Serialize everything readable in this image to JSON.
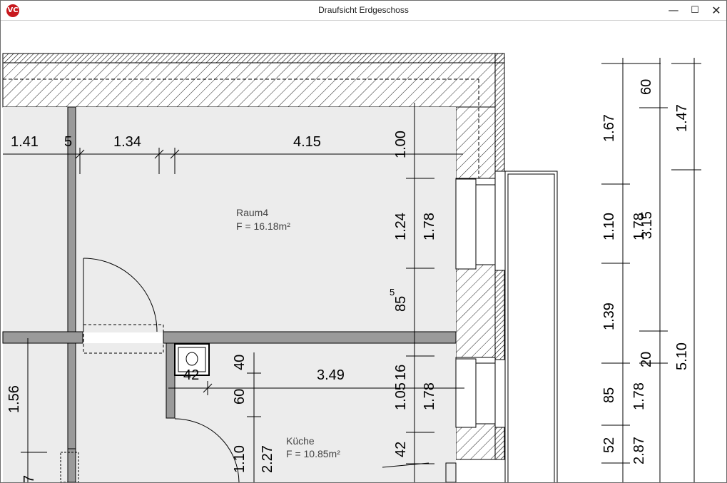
{
  "window": {
    "title": "Draufsicht Erdgeschoss",
    "app_icon_text": "VC",
    "controls": {
      "minimize": "—",
      "maximize": "☐",
      "close": "✕"
    }
  },
  "rooms": [
    {
      "name": "Raum4",
      "area": "F = 16.18m²"
    },
    {
      "name": "Küche",
      "area": "F = 10.85m²"
    }
  ],
  "dims_horizontal": {
    "d1": "1.41",
    "d2": "5",
    "d3": "1.34",
    "d4": "4.15",
    "d5": "3.49",
    "d6": "42"
  },
  "dims_inner_vertical": {
    "a1": "1.00",
    "a2": "1.24",
    "a3": "85",
    "a3_sup": "5",
    "a4": "1.05",
    "a4_sup": "16",
    "a5": "42",
    "b1": "1.78",
    "b2": "1.78",
    "c1": "40",
    "c2": "60",
    "c3": "1.10",
    "c4": "2.27",
    "c5": "1.56",
    "c6": "7"
  },
  "dims_right": {
    "r1": "1.67",
    "r2": "1.10",
    "r3": "1.39",
    "r4": "85",
    "r5": "52",
    "s1": "1.78",
    "s1_overlap": "3.15",
    "s2": "1.78",
    "s3": "2.87",
    "t1": "60",
    "t2": "1.47",
    "t3": "20",
    "t4": "5.10"
  },
  "colors": {
    "floor": "#ececec",
    "wall": "#9a9a9a",
    "hatch": "#222222",
    "app_icon": "#c8191e"
  }
}
